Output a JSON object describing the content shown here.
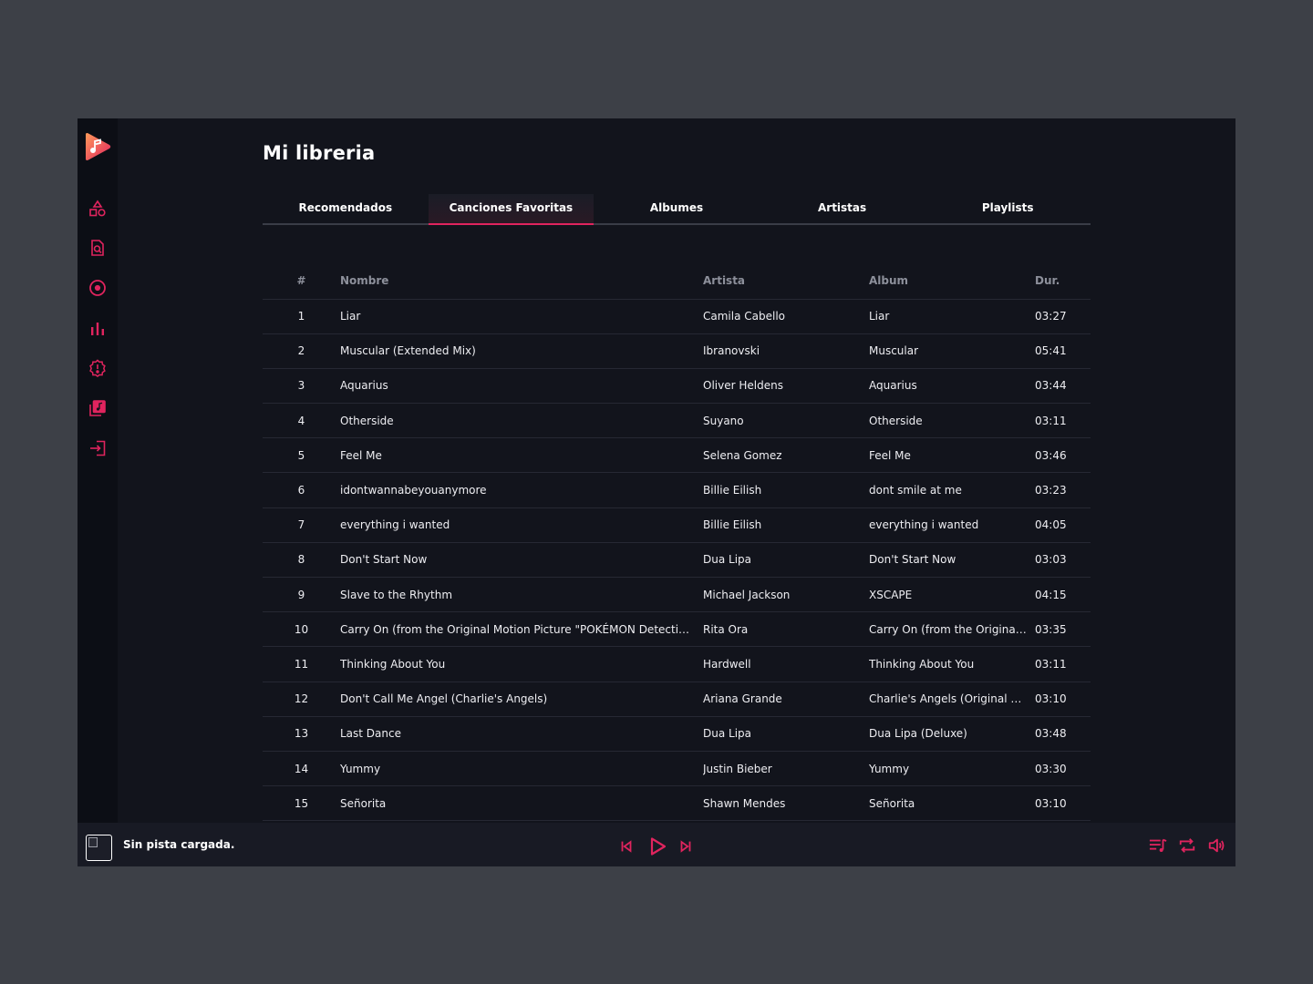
{
  "colors": {
    "accent": "#e0245e",
    "background": "#12141c",
    "sidebar": "#0c0e15",
    "player_bar": "#181a24"
  },
  "sidebar": {
    "logo": "music-play-logo",
    "items": [
      {
        "icon": "shapes-icon"
      },
      {
        "icon": "search-document-icon"
      },
      {
        "icon": "disc-icon"
      },
      {
        "icon": "bar-chart-icon"
      },
      {
        "icon": "alert-badge-icon"
      },
      {
        "icon": "music-library-icon"
      },
      {
        "icon": "logout-icon"
      }
    ]
  },
  "main": {
    "title": "Mi libreria",
    "tabs": [
      {
        "label": "Recomendados",
        "active": false
      },
      {
        "label": "Canciones Favoritas",
        "active": true
      },
      {
        "label": "Albumes",
        "active": false
      },
      {
        "label": "Artistas",
        "active": false
      },
      {
        "label": "Playlists",
        "active": false
      }
    ],
    "table": {
      "headers": {
        "num": "#",
        "name": "Nombre",
        "artist": "Artista",
        "album": "Album",
        "duration": "Dur."
      },
      "rows": [
        {
          "num": "1",
          "name": "Liar",
          "artist": "Camila Cabello",
          "album": "Liar",
          "duration": "03:27"
        },
        {
          "num": "2",
          "name": "Muscular (Extended Mix)",
          "artist": "Ibranovski",
          "album": "Muscular",
          "duration": "05:41"
        },
        {
          "num": "3",
          "name": "Aquarius",
          "artist": "Oliver Heldens",
          "album": "Aquarius",
          "duration": "03:44"
        },
        {
          "num": "4",
          "name": "Otherside",
          "artist": "Suyano",
          "album": "Otherside",
          "duration": "03:11"
        },
        {
          "num": "5",
          "name": "Feel Me",
          "artist": "Selena Gomez",
          "album": "Feel Me",
          "duration": "03:46"
        },
        {
          "num": "6",
          "name": "idontwannabeyouanymore",
          "artist": "Billie Eilish",
          "album": "dont smile at me",
          "duration": "03:23"
        },
        {
          "num": "7",
          "name": "everything i wanted",
          "artist": "Billie Eilish",
          "album": "everything i wanted",
          "duration": "04:05"
        },
        {
          "num": "8",
          "name": "Don't Start Now",
          "artist": "Dua Lipa",
          "album": "Don't Start Now",
          "duration": "03:03"
        },
        {
          "num": "9",
          "name": "Slave to the Rhythm",
          "artist": "Michael Jackson",
          "album": "XSCAPE",
          "duration": "04:15"
        },
        {
          "num": "10",
          "name": "Carry On (from the Original Motion Picture \"POKÉMON Detective P...",
          "artist": "Rita Ora",
          "album": "Carry On (from the Original ...",
          "duration": "03:35"
        },
        {
          "num": "11",
          "name": "Thinking About You",
          "artist": "Hardwell",
          "album": "Thinking About You",
          "duration": "03:11"
        },
        {
          "num": "12",
          "name": "Don't Call Me Angel (Charlie's Angels)",
          "artist": "Ariana Grande",
          "album": "Charlie's Angels (Original M...",
          "duration": "03:10"
        },
        {
          "num": "13",
          "name": "Last Dance",
          "artist": "Dua Lipa",
          "album": "Dua Lipa (Deluxe)",
          "duration": "03:48"
        },
        {
          "num": "14",
          "name": "Yummy",
          "artist": "Justin Bieber",
          "album": "Yummy",
          "duration": "03:30"
        },
        {
          "num": "15",
          "name": "Señorita",
          "artist": "Shawn Mendes",
          "album": "Señorita",
          "duration": "03:10"
        }
      ]
    }
  },
  "player": {
    "status": "Sin pista cargada.",
    "controls": [
      "previous-icon",
      "play-icon",
      "next-icon"
    ],
    "right_controls": [
      "queue-icon",
      "repeat-icon",
      "volume-icon"
    ]
  }
}
